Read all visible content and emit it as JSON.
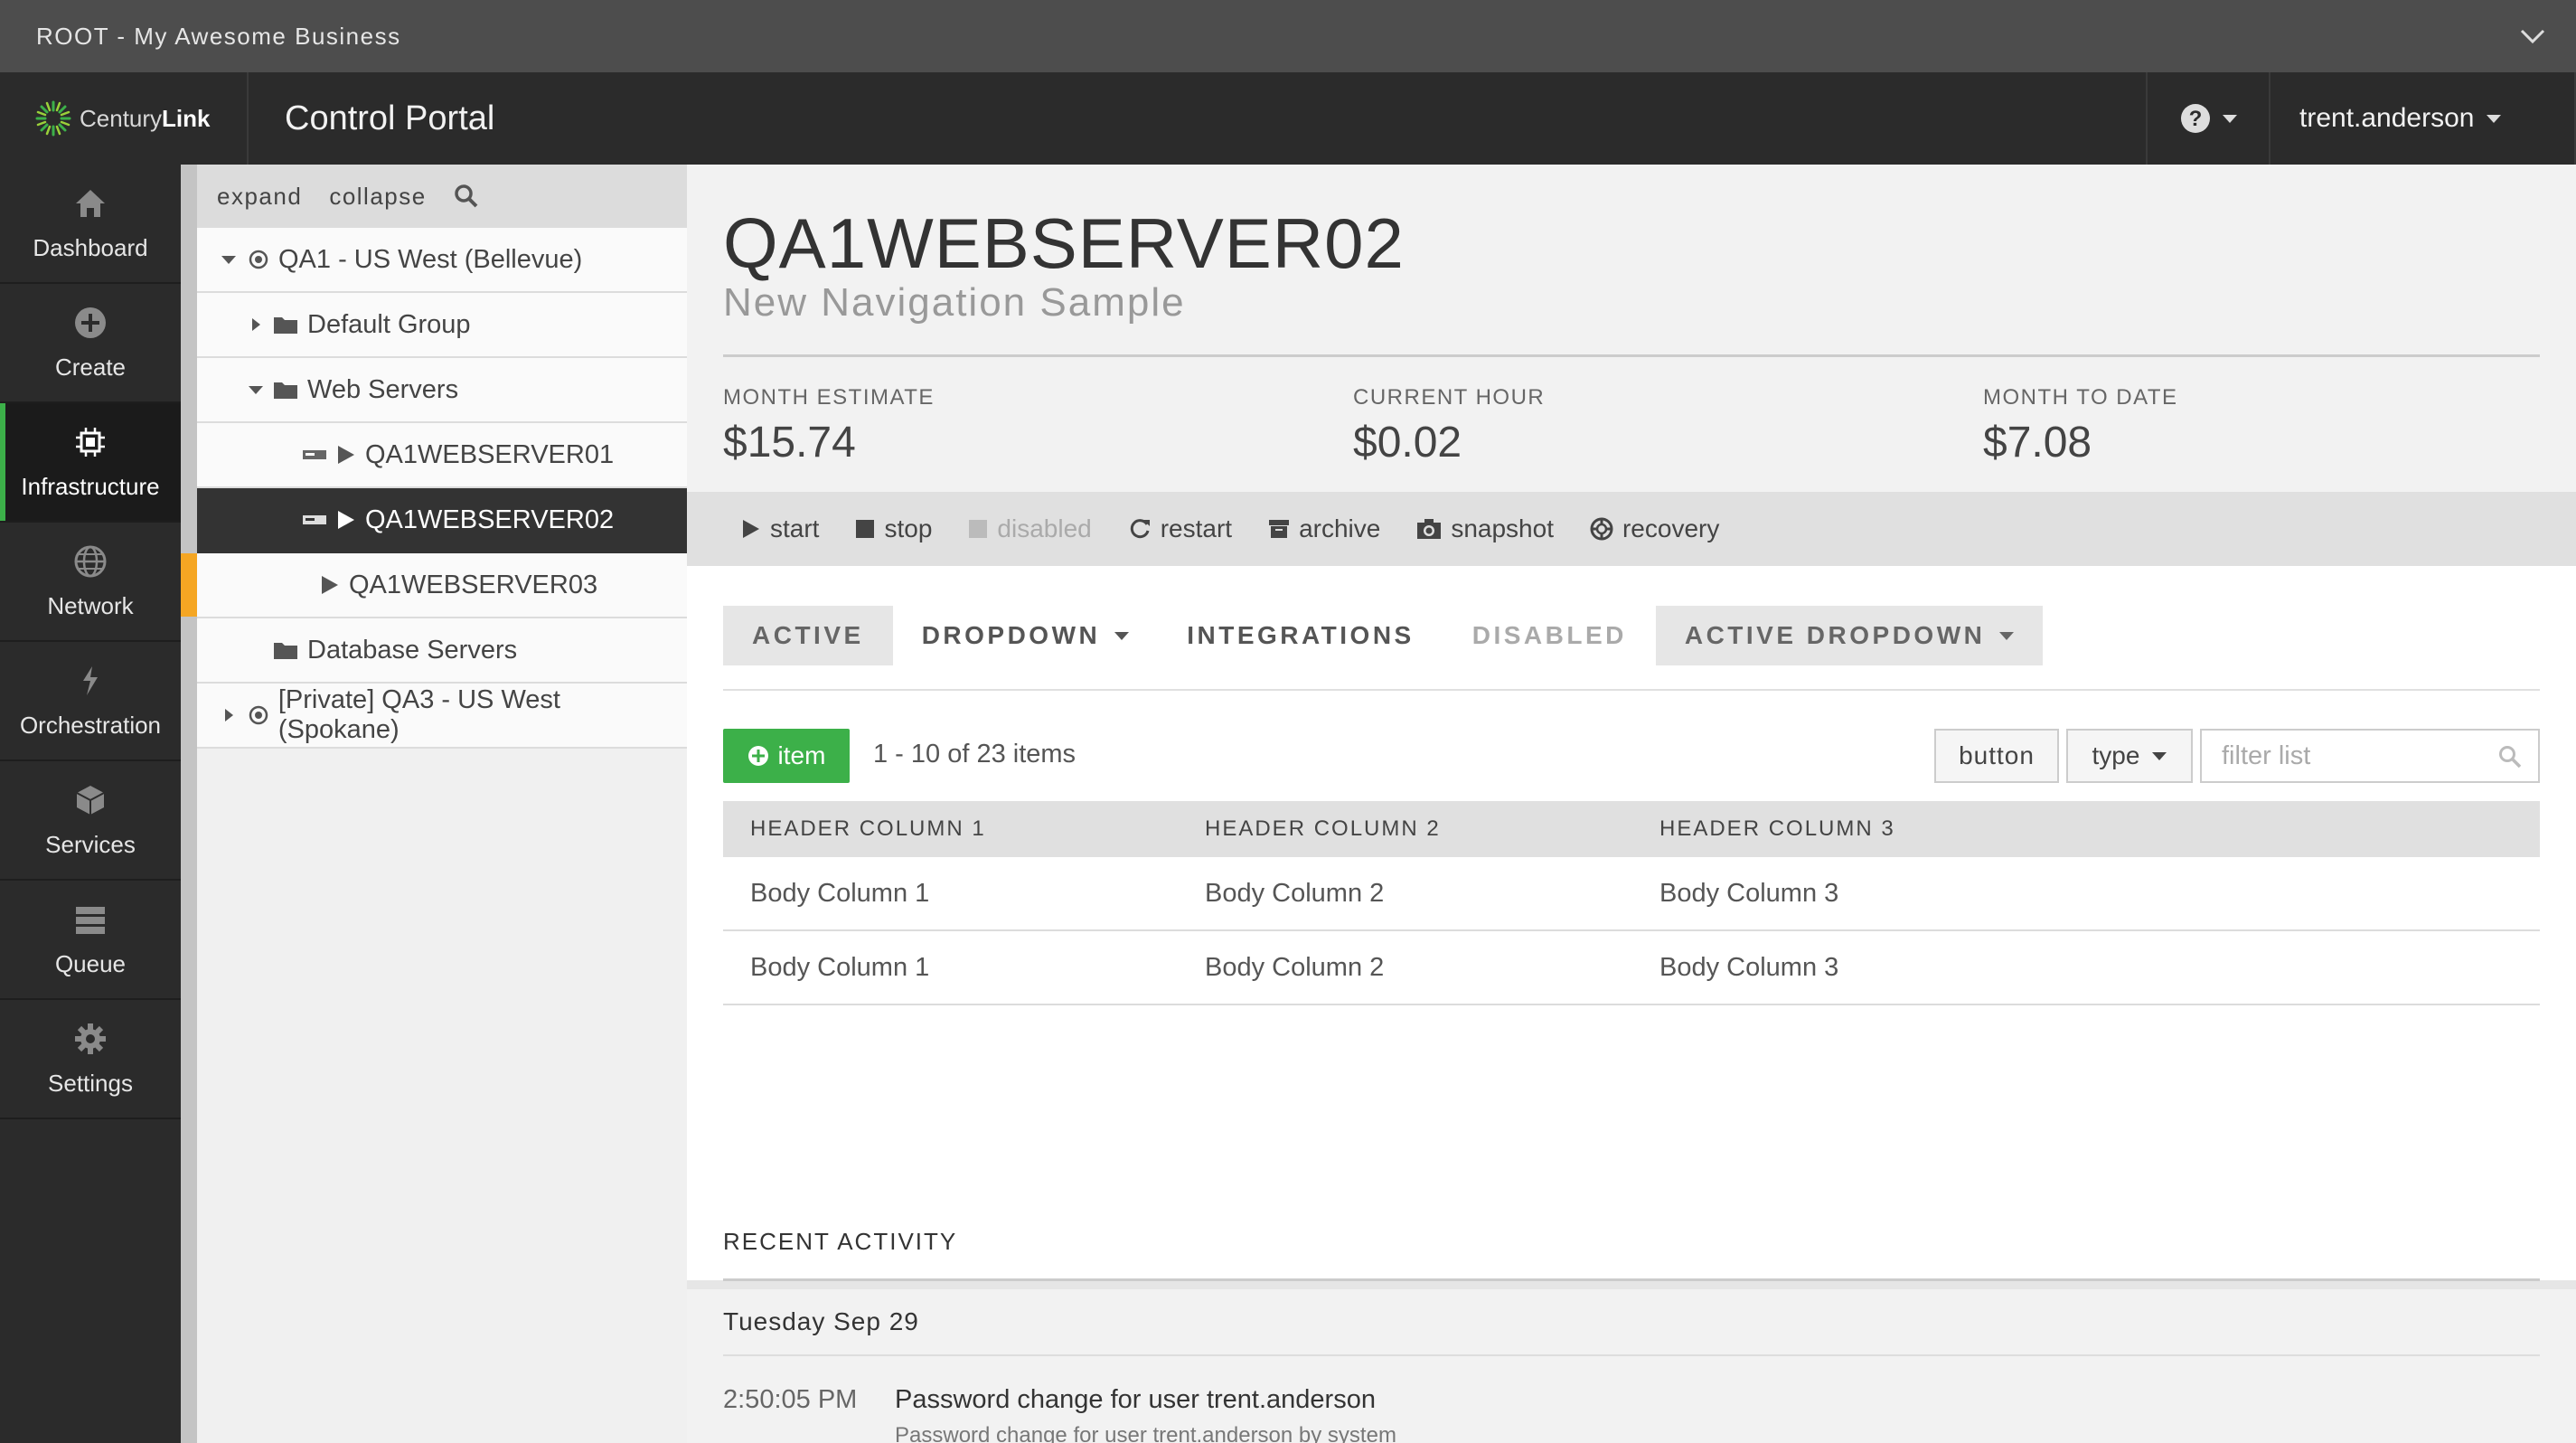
{
  "topbar": {
    "account": "ROOT - My Awesome Business"
  },
  "header": {
    "logo_text": "Century",
    "logo_bold": "Link",
    "portal_title": "Control Portal",
    "username": "trent.anderson"
  },
  "sidenav": {
    "items": [
      {
        "label": "Dashboard",
        "icon": "home-icon"
      },
      {
        "label": "Create",
        "icon": "plus-circle-icon"
      },
      {
        "label": "Infrastructure",
        "icon": "chip-icon"
      },
      {
        "label": "Network",
        "icon": "globe-icon"
      },
      {
        "label": "Orchestration",
        "icon": "orchestration-icon"
      },
      {
        "label": "Services",
        "icon": "cube-icon"
      },
      {
        "label": "Queue",
        "icon": "queue-icon"
      },
      {
        "label": "Settings",
        "icon": "gear-icon"
      }
    ]
  },
  "tree": {
    "expand": "expand",
    "collapse": "collapse",
    "rows": [
      "QA1 - US West (Bellevue)",
      "Default Group",
      "Web Servers",
      "QA1WEBSERVER01",
      "QA1WEBSERVER02",
      "QA1WEBSERVER03",
      "Database Servers",
      "[Private] QA3 - US West (Spokane)"
    ]
  },
  "server": {
    "name": "QA1WEBSERVER02",
    "subtitle": "New Navigation Sample"
  },
  "metrics": [
    {
      "label": "MONTH ESTIMATE",
      "value": "$15.74"
    },
    {
      "label": "CURRENT HOUR",
      "value": "$0.02"
    },
    {
      "label": "MONTH TO DATE",
      "value": "$7.08"
    }
  ],
  "actions": [
    "start",
    "stop",
    "disabled",
    "restart",
    "archive",
    "snapshot",
    "recovery"
  ],
  "tabs": [
    "ACTIVE",
    "DROPDOWN",
    "INTEGRATIONS",
    "DISABLED",
    "ACTIVE DROPDOWN"
  ],
  "list": {
    "add_label": "item",
    "count": "1 - 10 of 23 items",
    "button_label": "button",
    "type_label": "type",
    "filter_placeholder": "filter list"
  },
  "table": {
    "headers": [
      "HEADER COLUMN 1",
      "HEADER COLUMN 2",
      "HEADER COLUMN 3"
    ],
    "rows": [
      [
        "Body Column 1",
        "Body Column 2",
        "Body Column 3"
      ],
      [
        "Body Column 1",
        "Body Column 2",
        "Body Column 3"
      ]
    ]
  },
  "activity": {
    "title": "RECENT ACTIVITY",
    "date": "Tuesday Sep 29",
    "time": "2:50:05 PM",
    "message": "Password change for user trent.anderson",
    "detail": "Password change for user trent.anderson by system"
  },
  "colors": {
    "accent_green": "#3cb049",
    "flag_orange": "#f5a623",
    "dark": "#2b2b2b"
  }
}
